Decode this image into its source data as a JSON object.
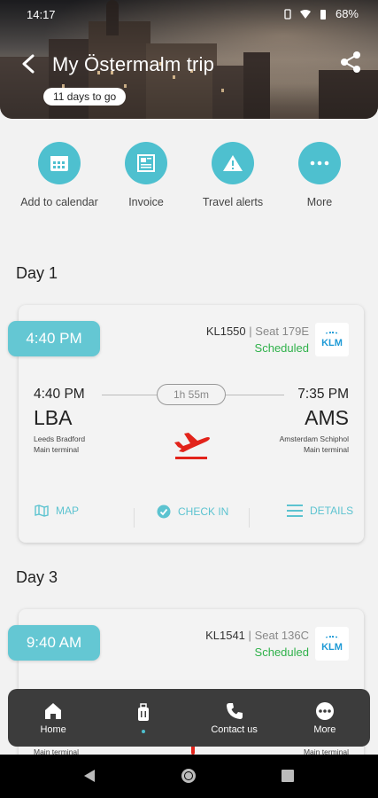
{
  "status_bar": {
    "time": "14:17",
    "battery": "68%"
  },
  "header": {
    "title": "My Östermalm trip",
    "countdown": "11 days to go"
  },
  "actions": [
    {
      "label": "Add to calendar",
      "icon": "calendar-icon"
    },
    {
      "label": "Invoice",
      "icon": "invoice-icon"
    },
    {
      "label": "Travel alerts",
      "icon": "alert-icon"
    },
    {
      "label": "More",
      "icon": "more-icon"
    }
  ],
  "trip": {
    "days": [
      {
        "label": "Day 1",
        "flight": {
          "badge_time": "4:40 PM",
          "flight_number": "KL1550",
          "seat": "Seat 179E",
          "status": "Scheduled",
          "airline_logo": "KLM",
          "departure": {
            "time": "4:40 PM",
            "code": "LBA",
            "airport": "Leeds Bradford",
            "terminal": "Main terminal"
          },
          "arrival": {
            "time": "7:35 PM",
            "code": "AMS",
            "airport": "Amsterdam Schiphol",
            "terminal": "Main terminal"
          },
          "duration": "1h 55m",
          "actions": {
            "map": "MAP",
            "checkin": "CHECK IN",
            "details": "DETAILS"
          }
        }
      },
      {
        "label": "Day 3",
        "flight": {
          "badge_time": "9:40 AM",
          "flight_number": "KL1541",
          "seat": "Seat 136C",
          "status": "Scheduled",
          "airline_logo": "KLM",
          "departure": {
            "terminal": "Main terminal"
          },
          "arrival": {
            "terminal": "Main terminal"
          }
        }
      }
    ]
  },
  "bottom_nav": [
    {
      "label": "Home",
      "icon": "home-icon"
    },
    {
      "label": "",
      "icon": "luggage-icon",
      "active": true
    },
    {
      "label": "Contact us",
      "icon": "phone-icon"
    },
    {
      "label": "More",
      "icon": "more-dots-icon"
    }
  ],
  "colors": {
    "accent": "#4ec0cf",
    "status_ok": "#2fb14a",
    "klm_blue": "#1e9ad6",
    "plane_red": "#e2231a"
  }
}
